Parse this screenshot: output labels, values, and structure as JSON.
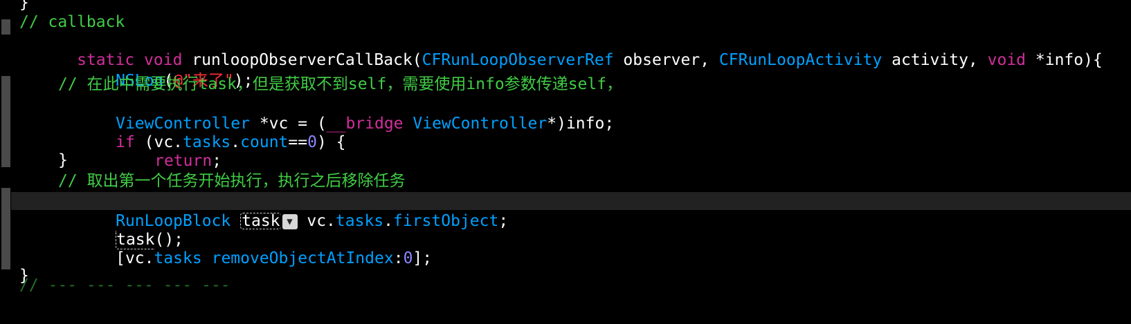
{
  "editor": {
    "lines": [
      {
        "t1": "}"
      },
      {
        "t1": "// callback"
      },
      {
        "kw1": "static",
        "kw2": "void",
        "fn": " runloopObserverCallBack(",
        "ty1": "CFRunLoopObserverRef",
        "p1": " observer, ",
        "ty2": "CFRunLoopActivity",
        "p2": " activity, ",
        "kw3": "void",
        "p3": " *info){"
      },
      {
        "ty": "NSLog",
        "p1": "(",
        "str": "@\"来了\"",
        "p2": ");"
      },
      {
        "cm": "// 在此中需要执行task，但是获取不到self，需要使用info参数传递self，"
      },
      {
        "ty1": "ViewController",
        "p1": " *vc = (",
        "kw": "__bridge",
        "p2": " ",
        "ty2": "ViewController",
        "p3": "*)info;"
      },
      {
        "kw": "if",
        "p1": " (vc.",
        "ty1": "tasks",
        "p2": ".",
        "ty2": "count",
        "p3": "==",
        "num": "0",
        "p4": ") {"
      },
      {
        "kw": "return",
        "p1": ";"
      },
      {
        "p1": "}"
      },
      {
        "cm": "// 取出第一个任务开始执行，执行之后移除任务"
      },
      {
        "ty1": "RunLoopBlock",
        "p1": " ",
        "ph": "task",
        "dd": "▼",
        "p2": " vc.",
        "ty2": "tasks",
        "p3": ".",
        "ty3": "firstObject",
        "p4": ";"
      },
      {
        "ph": "task",
        "p1": "();"
      },
      {
        "p1": "[vc.",
        "ty1": "tasks",
        "p2": " ",
        "ty2": "removeObjectAtIndex",
        "p3": ":",
        "num": "0",
        "p4": "];"
      },
      {
        "p1": "}"
      }
    ],
    "stub": "//     ---    ---    ---     ---    ---"
  }
}
